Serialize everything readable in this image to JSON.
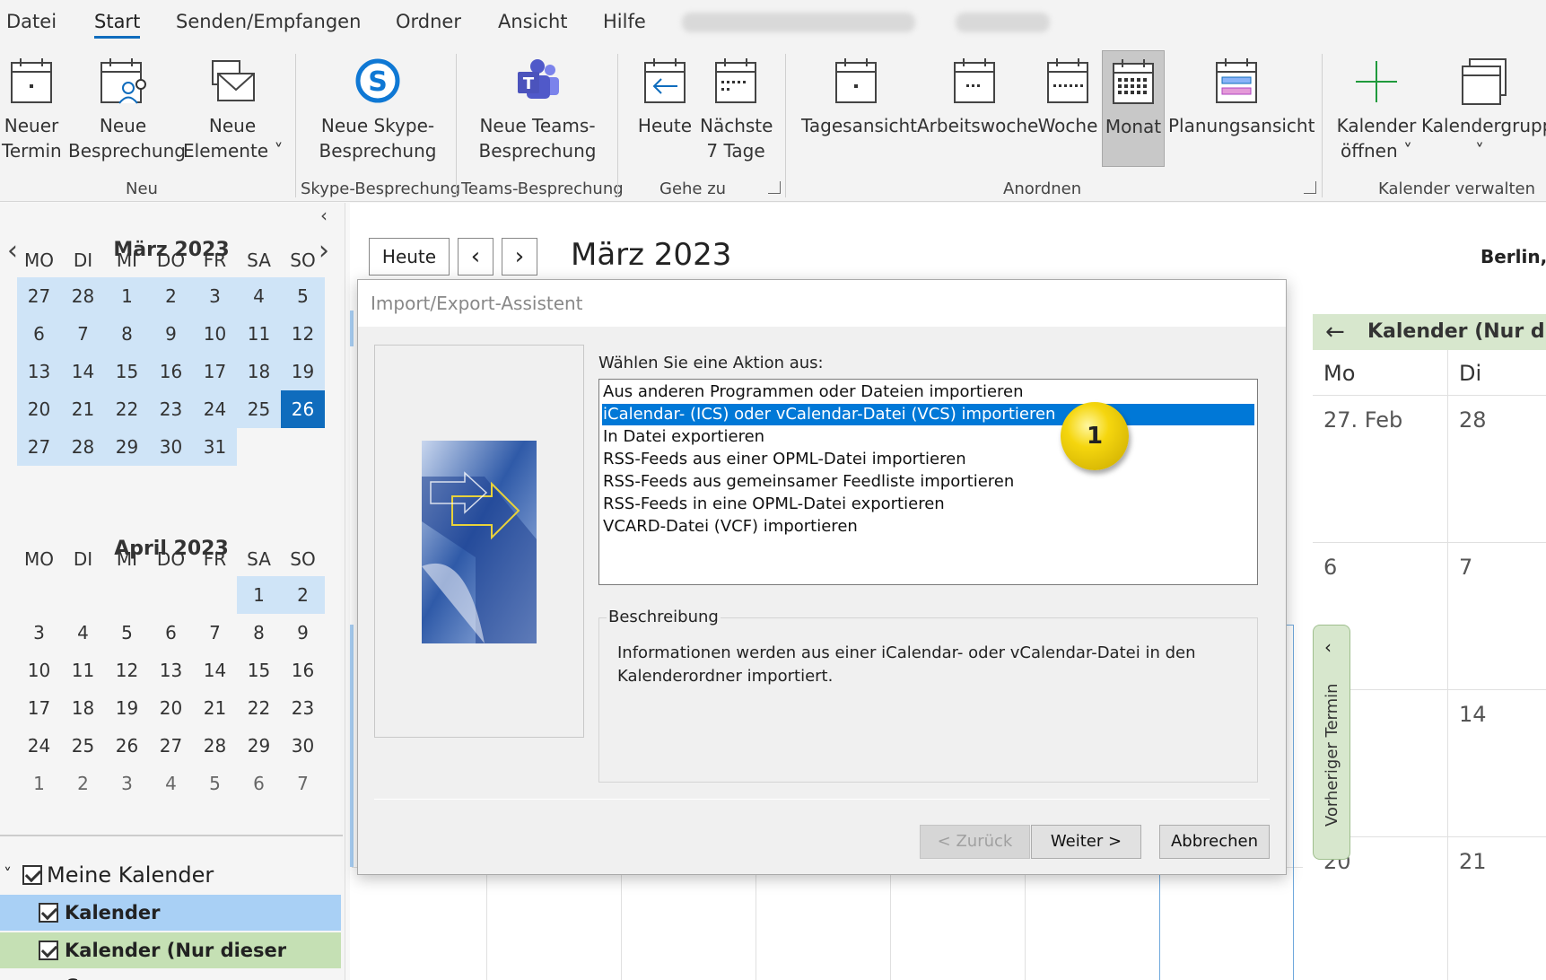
{
  "menubar": {
    "items": [
      "Datei",
      "Start",
      "Senden/Empfangen",
      "Ordner",
      "Ansicht",
      "Hilfe"
    ]
  },
  "ribbon": {
    "neu": {
      "neuer_termin": [
        "Neuer",
        "Termin"
      ],
      "neue_besprechung": [
        "Neue",
        "Besprechung"
      ],
      "neue_elemente": [
        "Neue",
        "Elemente ˅"
      ],
      "label": "Neu"
    },
    "skype": {
      "button": [
        "Neue Skype-",
        "Besprechung"
      ],
      "label": "Skype-Besprechung"
    },
    "teams": {
      "button": [
        "Neue Teams-",
        "Besprechung"
      ],
      "label": "Teams-Besprechung"
    },
    "gehezu": {
      "heute": "Heute",
      "naechste": [
        "Nächste",
        "7 Tage"
      ],
      "label": "Gehe zu"
    },
    "anordnen": {
      "tagesansicht": "Tagesansicht",
      "arbeitswoche": "Arbeitswoche",
      "woche": "Woche",
      "monat": "Monat",
      "planungsansicht": "Planungsansicht",
      "label": "Anordnen"
    },
    "verwalten": {
      "kalender_oeffnen": [
        "Kalender",
        "öffnen ˅"
      ],
      "kalendergruppen": [
        "Kalendergruppe",
        "˅"
      ],
      "label": "Kalender verwalten"
    }
  },
  "minical": {
    "march": {
      "title": "März 2023",
      "dow": [
        "MO",
        "DI",
        "MI",
        "DO",
        "FR",
        "SA",
        "SO"
      ],
      "weeks": [
        [
          "27",
          "28",
          "1",
          "2",
          "3",
          "4",
          "5"
        ],
        [
          "6",
          "7",
          "8",
          "9",
          "10",
          "11",
          "12"
        ],
        [
          "13",
          "14",
          "15",
          "16",
          "17",
          "18",
          "19"
        ],
        [
          "20",
          "21",
          "22",
          "23",
          "24",
          "25",
          "26"
        ],
        [
          "27",
          "28",
          "29",
          "30",
          "31",
          "",
          ""
        ]
      ]
    },
    "april": {
      "title": "April 2023",
      "dow": [
        "MO",
        "DI",
        "MI",
        "DO",
        "FR",
        "SA",
        "SO"
      ],
      "weeks": [
        [
          "",
          "",
          "",
          "",
          "",
          "1",
          "2"
        ],
        [
          "3",
          "4",
          "5",
          "6",
          "7",
          "8",
          "9"
        ],
        [
          "10",
          "11",
          "12",
          "13",
          "14",
          "15",
          "16"
        ],
        [
          "17",
          "18",
          "19",
          "20",
          "21",
          "22",
          "23"
        ],
        [
          "24",
          "25",
          "26",
          "27",
          "28",
          "29",
          "30"
        ],
        [
          "1",
          "2",
          "3",
          "4",
          "5",
          "6",
          "7"
        ]
      ]
    }
  },
  "my_calendars": {
    "group": "Meine Kalender",
    "items": [
      "Kalender",
      "Kalender (Nur dieser Comp..."
    ]
  },
  "main": {
    "today_button": "Heute",
    "title": "März 2023",
    "location": "Berlin, I"
  },
  "right_panel": {
    "header": "Kalender (Nur dies",
    "col1": "Mo",
    "col2": "Di",
    "cells": [
      "27. Feb",
      "28",
      "6",
      "7",
      "14",
      "20",
      "21"
    ],
    "vertical_tab": "Vorheriger Termin"
  },
  "dialog": {
    "title": "Import/Export-Assistent",
    "prompt": "Wählen Sie eine Aktion aus:",
    "actions": [
      "Aus anderen Programmen oder Dateien importieren",
      "iCalendar- (ICS) oder vCalendar-Datei (VCS) importieren",
      "In Datei exportieren",
      "RSS-Feeds aus einer OPML-Datei importieren",
      "RSS-Feeds aus gemeinsamer Feedliste importieren",
      "RSS-Feeds in eine OPML-Datei exportieren",
      "VCARD-Datei (VCF) importieren"
    ],
    "selected_index": 1,
    "description_label": "Beschreibung",
    "description": "Informationen werden aus einer iCalendar- oder vCalendar-Datei in den Kalenderordner importiert.",
    "buttons": {
      "back": "< Zurück",
      "next": "Weiter >",
      "cancel": "Abbrechen"
    },
    "badge": "1"
  },
  "colors": {
    "accent": "#0f6cbd",
    "selection": "#0078d7",
    "calendar_green": "#d7e7cd",
    "calendar_blue": "#a9d0f5"
  }
}
